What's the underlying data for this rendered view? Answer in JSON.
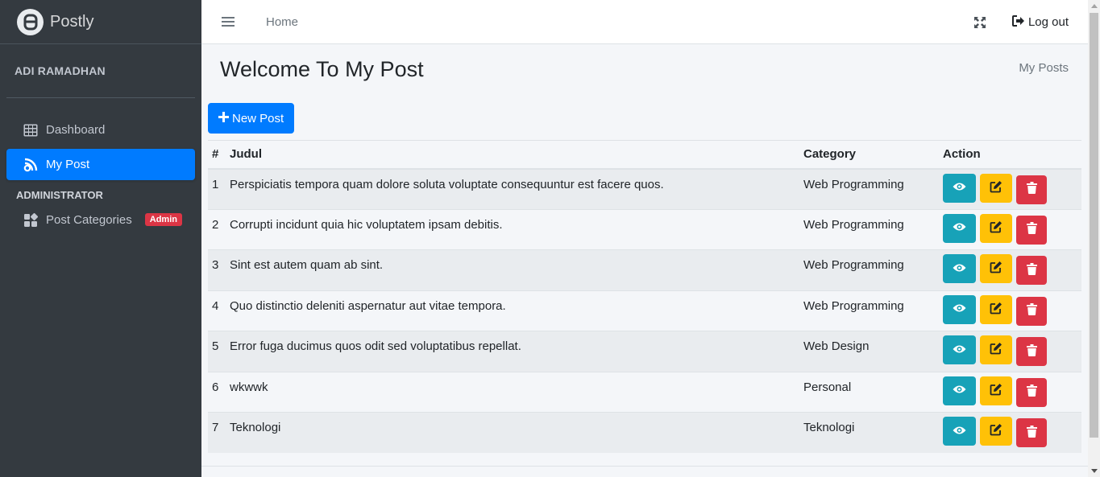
{
  "app": {
    "brand": "Postly"
  },
  "sidebar": {
    "user_name": "ADI RAMADHAN",
    "items": [
      {
        "label": "Dashboard",
        "icon": "table-icon",
        "active": false
      },
      {
        "label": "My Post",
        "icon": "blog-icon",
        "active": true
      }
    ],
    "section_header": "ADMINISTRATOR",
    "admin_items": [
      {
        "label": "Post Categories",
        "icon": "categories-icon",
        "badge": "Admin"
      }
    ]
  },
  "topbar": {
    "home_label": "Home",
    "logout_label": "Log out"
  },
  "page": {
    "title": "Welcome To My Post",
    "breadcrumb": "My Posts",
    "new_post_label": "New Post"
  },
  "table": {
    "headers": [
      "#",
      "Judul",
      "Category",
      "Action"
    ],
    "rows": [
      {
        "num": "1",
        "title": "Perspiciatis tempora quam dolore soluta voluptate consequuntur est facere quos.",
        "category": "Web Programming"
      },
      {
        "num": "2",
        "title": "Corrupti incidunt quia hic voluptatem ipsam debitis.",
        "category": "Web Programming"
      },
      {
        "num": "3",
        "title": "Sint est autem quam ab sint.",
        "category": "Web Programming"
      },
      {
        "num": "4",
        "title": "Quo distinctio deleniti aspernatur aut vitae tempora.",
        "category": "Web Programming"
      },
      {
        "num": "5",
        "title": "Error fuga ducimus quos odit sed voluptatibus repellat.",
        "category": "Web Design"
      },
      {
        "num": "6",
        "title": "wkwwk",
        "category": "Personal"
      },
      {
        "num": "7",
        "title": "Teknologi",
        "category": "Teknologi"
      }
    ]
  },
  "colors": {
    "sidebar_bg": "#343a40",
    "primary": "#007bff",
    "info": "#17a2b8",
    "warning": "#ffc107",
    "danger": "#dc3545"
  }
}
